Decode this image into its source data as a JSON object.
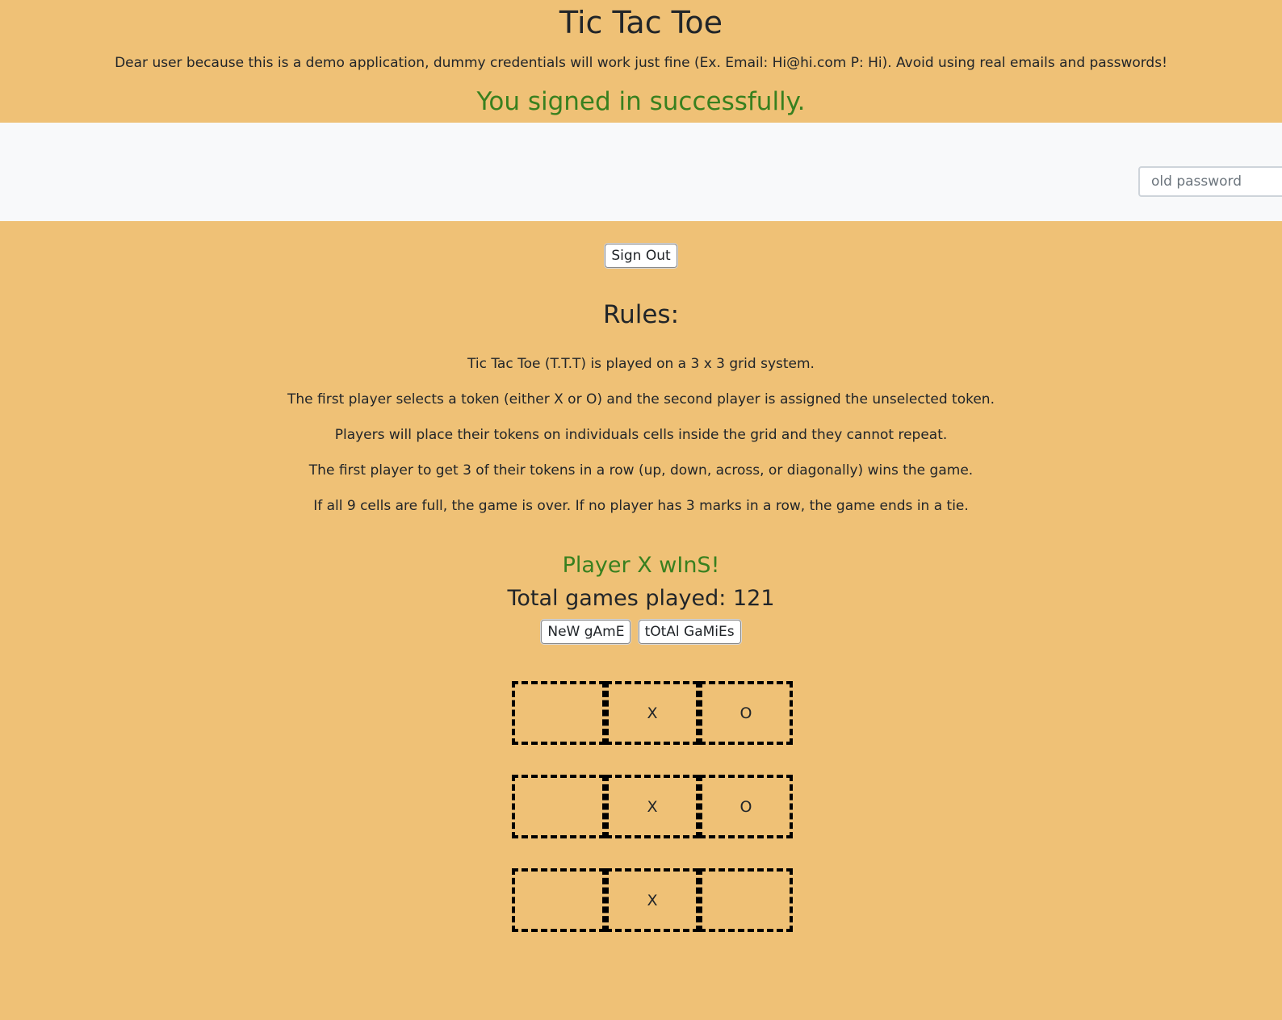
{
  "header": {
    "title": "Tic Tac Toe",
    "notice": "Dear user because this is a demo application, dummy credentials will work just fine (Ex. Email: Hi@hi.com P: Hi). Avoid using real emails and passwords!",
    "signin_message": "You signed in successfully."
  },
  "navbar": {
    "old_password_placeholder": "old password"
  },
  "account": {
    "sign_out_label": "Sign Out"
  },
  "rules": {
    "title": "Rules:",
    "items": [
      "Tic Tac Toe (T.T.T) is played on a 3 x 3 grid system.",
      "The first player selects a token (either X or O) and the second player is assigned the unselected token.",
      "Players will place their tokens on individuals cells inside the grid and they cannot repeat.",
      "The first player to get 3 of their tokens in a row (up, down, across, or diagonally) wins the game.",
      "If all 9 cells are full, the game is over. If no player has 3 marks in a row, the game ends in a tie."
    ]
  },
  "game": {
    "status_message": "Player X wInS!",
    "total_games_text": "Total games played: 121",
    "new_game_label": "NeW gAmE",
    "total_games_label": "tOtAl GaMiEs",
    "board": [
      [
        "",
        "X",
        "O"
      ],
      [
        "",
        "X",
        "O"
      ],
      [
        "",
        "X",
        ""
      ]
    ]
  },
  "colors": {
    "background": "#efc176",
    "navbar": "#f8f9fa",
    "success_text": "#38801f"
  }
}
